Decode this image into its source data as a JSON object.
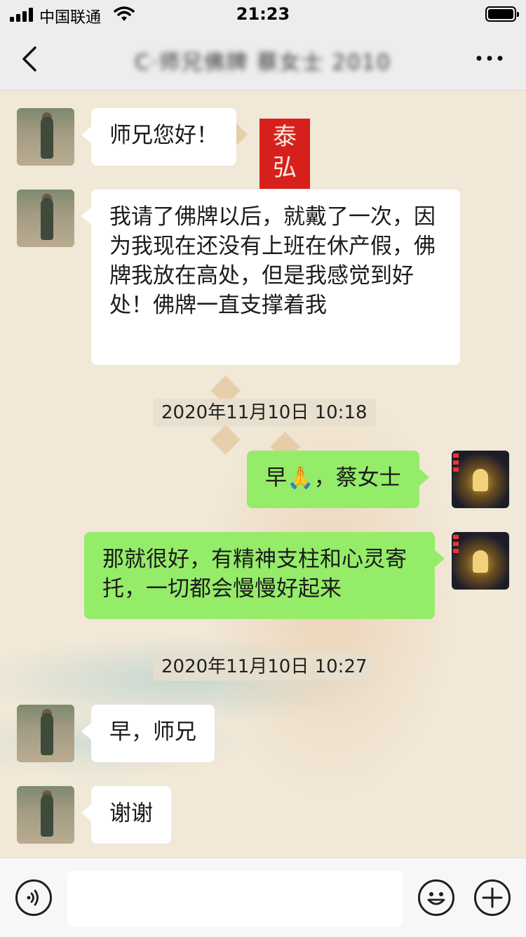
{
  "status_bar": {
    "carrier": "中国联通",
    "time": "21:23"
  },
  "nav": {
    "title": "C·师兄佛牌 蔡女士 2010",
    "back_icon": "chevron-left-icon",
    "more_icon": "more-dots-icon"
  },
  "background_text": [
    "泰",
    "弘"
  ],
  "messages": [
    {
      "side": "in",
      "text": "师兄您好！"
    },
    {
      "side": "in",
      "text": "我请了佛牌以后，就戴了一次，因为我现在还没有上班在休产假，佛牌我放在高处，但是我感觉到好处！佛牌一直支撑着我"
    },
    {
      "type": "time",
      "text": "2020年11月10日 10:18"
    },
    {
      "side": "out",
      "text": "早🙏，蔡女士"
    },
    {
      "side": "out",
      "text": "那就很好，有精神支柱和心灵寄托，一切都会慢慢好起来"
    },
    {
      "type": "time",
      "text": "2020年11月10日 10:27"
    },
    {
      "side": "in",
      "text": "早，师兄"
    },
    {
      "side": "in",
      "text": "谢谢"
    }
  ],
  "input_bar": {
    "voice_icon": "voice-icon",
    "emoji_icon": "emoji-icon",
    "plus_icon": "plus-icon",
    "placeholder": ""
  }
}
